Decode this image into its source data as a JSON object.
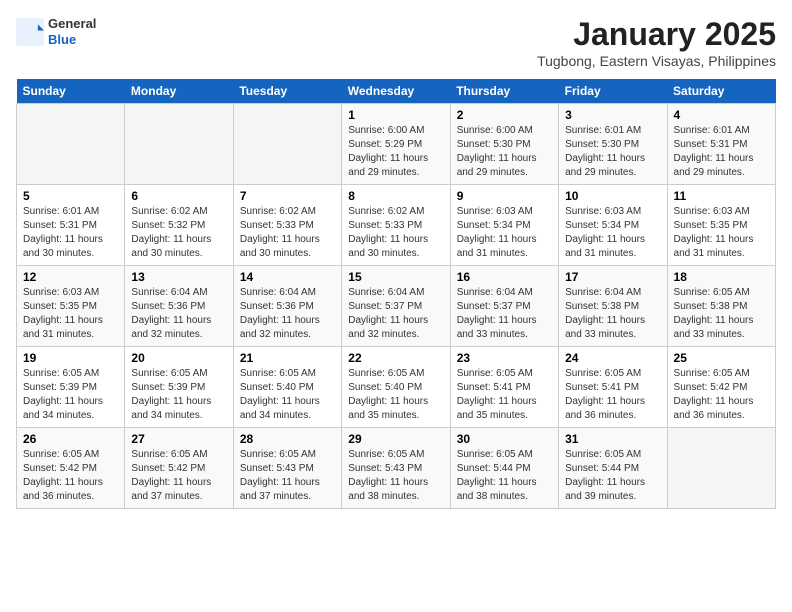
{
  "header": {
    "logo_general": "General",
    "logo_blue": "Blue",
    "month_title": "January 2025",
    "location": "Tugbong, Eastern Visayas, Philippines"
  },
  "days_of_week": [
    "Sunday",
    "Monday",
    "Tuesday",
    "Wednesday",
    "Thursday",
    "Friday",
    "Saturday"
  ],
  "weeks": [
    [
      {
        "day": "",
        "info": ""
      },
      {
        "day": "",
        "info": ""
      },
      {
        "day": "",
        "info": ""
      },
      {
        "day": "1",
        "info": "Sunrise: 6:00 AM\nSunset: 5:29 PM\nDaylight: 11 hours and 29 minutes."
      },
      {
        "day": "2",
        "info": "Sunrise: 6:00 AM\nSunset: 5:30 PM\nDaylight: 11 hours and 29 minutes."
      },
      {
        "day": "3",
        "info": "Sunrise: 6:01 AM\nSunset: 5:30 PM\nDaylight: 11 hours and 29 minutes."
      },
      {
        "day": "4",
        "info": "Sunrise: 6:01 AM\nSunset: 5:31 PM\nDaylight: 11 hours and 29 minutes."
      }
    ],
    [
      {
        "day": "5",
        "info": "Sunrise: 6:01 AM\nSunset: 5:31 PM\nDaylight: 11 hours and 30 minutes."
      },
      {
        "day": "6",
        "info": "Sunrise: 6:02 AM\nSunset: 5:32 PM\nDaylight: 11 hours and 30 minutes."
      },
      {
        "day": "7",
        "info": "Sunrise: 6:02 AM\nSunset: 5:33 PM\nDaylight: 11 hours and 30 minutes."
      },
      {
        "day": "8",
        "info": "Sunrise: 6:02 AM\nSunset: 5:33 PM\nDaylight: 11 hours and 30 minutes."
      },
      {
        "day": "9",
        "info": "Sunrise: 6:03 AM\nSunset: 5:34 PM\nDaylight: 11 hours and 31 minutes."
      },
      {
        "day": "10",
        "info": "Sunrise: 6:03 AM\nSunset: 5:34 PM\nDaylight: 11 hours and 31 minutes."
      },
      {
        "day": "11",
        "info": "Sunrise: 6:03 AM\nSunset: 5:35 PM\nDaylight: 11 hours and 31 minutes."
      }
    ],
    [
      {
        "day": "12",
        "info": "Sunrise: 6:03 AM\nSunset: 5:35 PM\nDaylight: 11 hours and 31 minutes."
      },
      {
        "day": "13",
        "info": "Sunrise: 6:04 AM\nSunset: 5:36 PM\nDaylight: 11 hours and 32 minutes."
      },
      {
        "day": "14",
        "info": "Sunrise: 6:04 AM\nSunset: 5:36 PM\nDaylight: 11 hours and 32 minutes."
      },
      {
        "day": "15",
        "info": "Sunrise: 6:04 AM\nSunset: 5:37 PM\nDaylight: 11 hours and 32 minutes."
      },
      {
        "day": "16",
        "info": "Sunrise: 6:04 AM\nSunset: 5:37 PM\nDaylight: 11 hours and 33 minutes."
      },
      {
        "day": "17",
        "info": "Sunrise: 6:04 AM\nSunset: 5:38 PM\nDaylight: 11 hours and 33 minutes."
      },
      {
        "day": "18",
        "info": "Sunrise: 6:05 AM\nSunset: 5:38 PM\nDaylight: 11 hours and 33 minutes."
      }
    ],
    [
      {
        "day": "19",
        "info": "Sunrise: 6:05 AM\nSunset: 5:39 PM\nDaylight: 11 hours and 34 minutes."
      },
      {
        "day": "20",
        "info": "Sunrise: 6:05 AM\nSunset: 5:39 PM\nDaylight: 11 hours and 34 minutes."
      },
      {
        "day": "21",
        "info": "Sunrise: 6:05 AM\nSunset: 5:40 PM\nDaylight: 11 hours and 34 minutes."
      },
      {
        "day": "22",
        "info": "Sunrise: 6:05 AM\nSunset: 5:40 PM\nDaylight: 11 hours and 35 minutes."
      },
      {
        "day": "23",
        "info": "Sunrise: 6:05 AM\nSunset: 5:41 PM\nDaylight: 11 hours and 35 minutes."
      },
      {
        "day": "24",
        "info": "Sunrise: 6:05 AM\nSunset: 5:41 PM\nDaylight: 11 hours and 36 minutes."
      },
      {
        "day": "25",
        "info": "Sunrise: 6:05 AM\nSunset: 5:42 PM\nDaylight: 11 hours and 36 minutes."
      }
    ],
    [
      {
        "day": "26",
        "info": "Sunrise: 6:05 AM\nSunset: 5:42 PM\nDaylight: 11 hours and 36 minutes."
      },
      {
        "day": "27",
        "info": "Sunrise: 6:05 AM\nSunset: 5:42 PM\nDaylight: 11 hours and 37 minutes."
      },
      {
        "day": "28",
        "info": "Sunrise: 6:05 AM\nSunset: 5:43 PM\nDaylight: 11 hours and 37 minutes."
      },
      {
        "day": "29",
        "info": "Sunrise: 6:05 AM\nSunset: 5:43 PM\nDaylight: 11 hours and 38 minutes."
      },
      {
        "day": "30",
        "info": "Sunrise: 6:05 AM\nSunset: 5:44 PM\nDaylight: 11 hours and 38 minutes."
      },
      {
        "day": "31",
        "info": "Sunrise: 6:05 AM\nSunset: 5:44 PM\nDaylight: 11 hours and 39 minutes."
      },
      {
        "day": "",
        "info": ""
      }
    ]
  ]
}
